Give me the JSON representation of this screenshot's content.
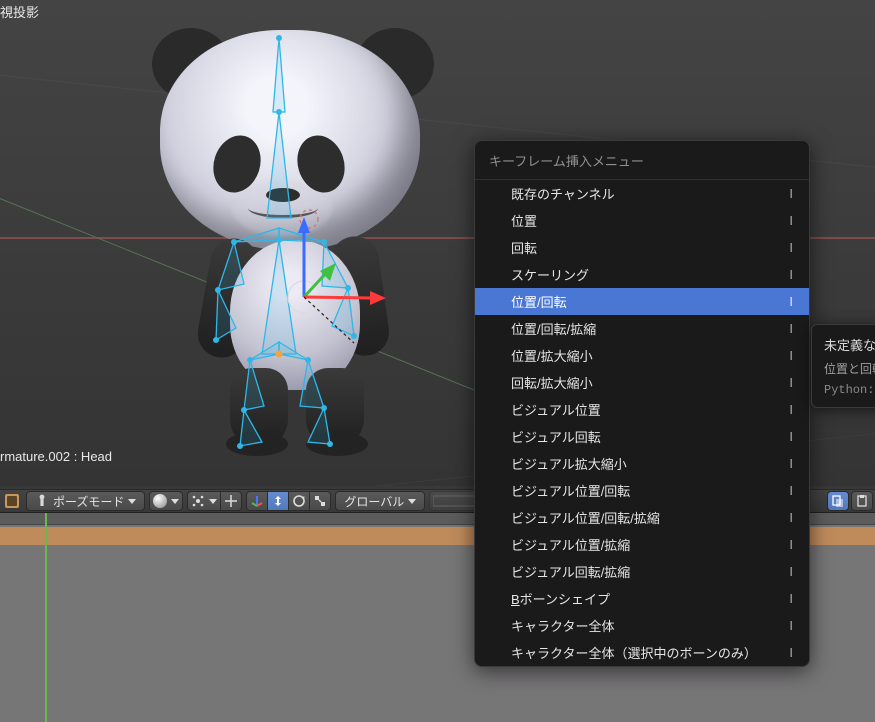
{
  "viewport": {
    "projection_label": "視投影",
    "selection_label": "rmature.002 : Head"
  },
  "header": {
    "mode_label": "ポーズモード",
    "orientation_label": "グローバル"
  },
  "menu": {
    "title": "キーフレーム挿入メニュー",
    "items": [
      {
        "label": "既存のチャンネル",
        "shortcut": "I",
        "highlight": false
      },
      {
        "label": "位置",
        "shortcut": "I",
        "highlight": false
      },
      {
        "label": "回転",
        "shortcut": "I",
        "highlight": false
      },
      {
        "label": "スケーリング",
        "shortcut": "I",
        "highlight": false
      },
      {
        "label": "位置/回転",
        "shortcut": "I",
        "highlight": true
      },
      {
        "label": "位置/回転/拡縮",
        "shortcut": "I",
        "highlight": false
      },
      {
        "label": "位置/拡大縮小",
        "shortcut": "I",
        "highlight": false
      },
      {
        "label": "回転/拡大縮小",
        "shortcut": "I",
        "highlight": false
      },
      {
        "label": "ビジュアル位置",
        "shortcut": "I",
        "highlight": false
      },
      {
        "label": "ビジュアル回転",
        "shortcut": "I",
        "highlight": false
      },
      {
        "label": "ビジュアル拡大縮小",
        "shortcut": "I",
        "highlight": false
      },
      {
        "label": "ビジュアル位置/回転",
        "shortcut": "I",
        "highlight": false
      },
      {
        "label": "ビジュアル位置/回転/拡縮",
        "shortcut": "I",
        "highlight": false
      },
      {
        "label": "ビジュアル位置/拡縮",
        "shortcut": "I",
        "highlight": false
      },
      {
        "label": "ビジュアル回転/拡縮",
        "shortcut": "I",
        "highlight": false
      },
      {
        "label": "Bボーンシェイプ",
        "shortcut": "I",
        "highlight": false,
        "accel_index": 0
      },
      {
        "label": "キャラクター全体",
        "shortcut": "I",
        "highlight": false
      },
      {
        "label": "キャラクター全体（選択中のボーンのみ）",
        "shortcut": "I",
        "highlight": false
      }
    ]
  },
  "tooltip": {
    "title": "未定義なら",
    "description": "位置と回転",
    "python": "Python:"
  }
}
